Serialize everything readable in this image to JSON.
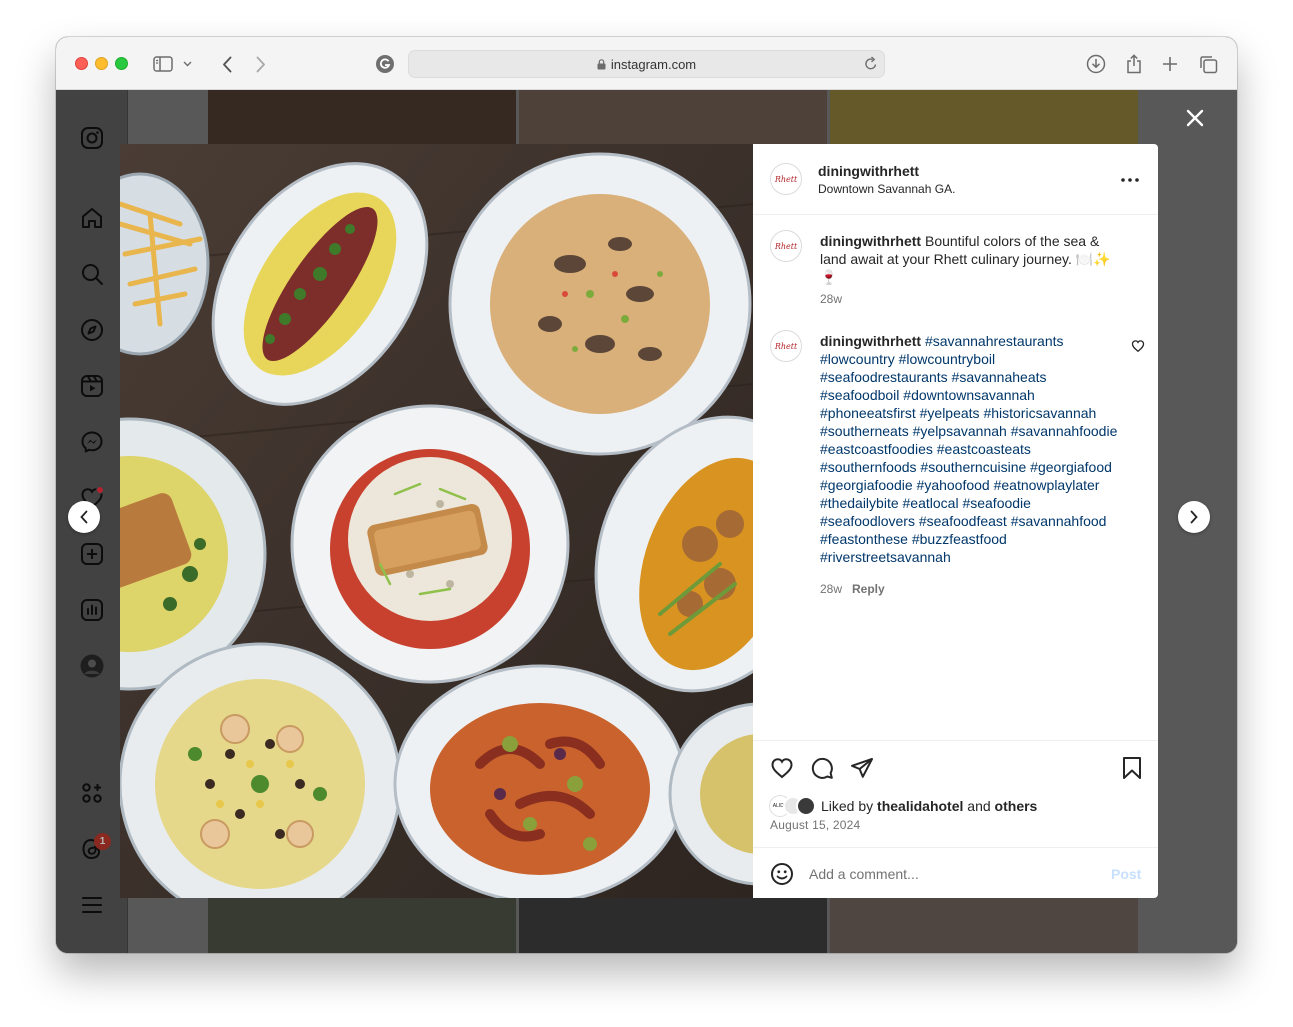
{
  "browser": {
    "url": "instagram.com"
  },
  "post": {
    "username": "diningwithrhett",
    "location": "Downtown Savannah GA.",
    "avatar_text": "Rhett",
    "caption": {
      "username": "diningwithrhett",
      "text": "Bountiful colors of the sea & land await at your Rhett culinary journey. 🍽️✨🍷",
      "time": "28w"
    },
    "comment": {
      "username": "diningwithrhett",
      "hashtags": [
        "#savannahrestaurants",
        "#lowcountry",
        "#lowcountryboil",
        "#seafoodrestaurants",
        "#savannaheats",
        "#seafoodboil",
        "#downtownsavannah",
        "#phoneeatsfirst",
        "#yelpeats",
        "#historicsavannah",
        "#southerneats",
        "#yelpsavannah",
        "#savannahfoodie",
        "#eastcoastfoodies",
        "#eastcoasteats",
        "#southernfoods",
        "#southerncuisine",
        "#georgiafood",
        "#georgiafoodie",
        "#yahoofood",
        "#eatnowplaylater",
        "#thedailybite",
        "#eatlocal",
        "#seafoodie",
        "#seafoodlovers",
        "#seafoodfeast",
        "#savannahfood",
        "#feastonthese",
        "#buzzfeastfood",
        "#riverstreetsavannah"
      ],
      "time": "28w",
      "reply_label": "Reply"
    },
    "likes": {
      "prefix": "Liked by",
      "user": "thealidahotel",
      "joiner": "and",
      "others": "others",
      "avatar_label": "ALIDA"
    },
    "date": "August 15, 2024",
    "comment_placeholder": "Add a comment...",
    "post_button": "Post"
  },
  "notifications": {
    "threads_badge": "1"
  }
}
